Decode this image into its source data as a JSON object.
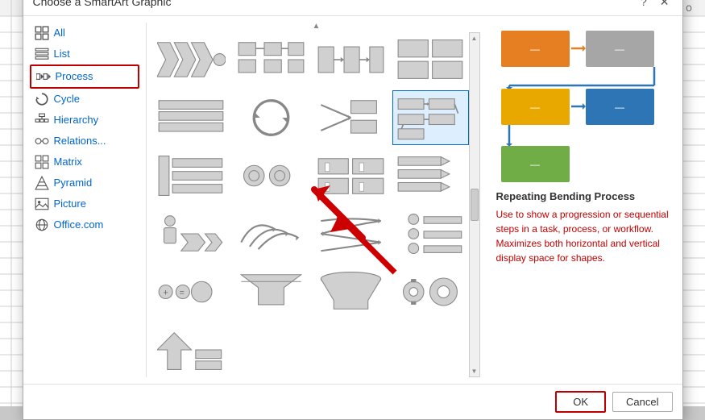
{
  "dialog": {
    "title": "Choose a SmartArt Graphic",
    "help_icon": "?",
    "close_icon": "✕"
  },
  "sidebar": {
    "items": [
      {
        "id": "all",
        "label": "All",
        "icon": "grid"
      },
      {
        "id": "list",
        "label": "List",
        "icon": "list"
      },
      {
        "id": "process",
        "label": "Process",
        "icon": "process",
        "active": true
      },
      {
        "id": "cycle",
        "label": "Cycle",
        "icon": "cycle"
      },
      {
        "id": "hierarchy",
        "label": "Hierarchy",
        "icon": "hierarchy"
      },
      {
        "id": "relations",
        "label": "Relations...",
        "icon": "relations"
      },
      {
        "id": "matrix",
        "label": "Matrix",
        "icon": "matrix"
      },
      {
        "id": "pyramid",
        "label": "Pyramid",
        "icon": "pyramid"
      },
      {
        "id": "picture",
        "label": "Picture",
        "icon": "picture"
      },
      {
        "id": "officecom",
        "label": "Office.com",
        "icon": "office"
      }
    ]
  },
  "preview": {
    "title": "Repeating Bending Process",
    "description": "Use to show a progression or sequential steps in a task, process, or workflow. Maximizes both horizontal and vertical display space for shapes."
  },
  "footer": {
    "ok_label": "OK",
    "cancel_label": "Cancel"
  },
  "colors": {
    "orange": "#E67E22",
    "blue": "#2E75B6",
    "green": "#70AD47",
    "gray": "#A6A6A6",
    "dark_gray": "#7F7F7F",
    "arrow_orange": "#E67E22",
    "arrow_blue": "#2E75B6"
  }
}
